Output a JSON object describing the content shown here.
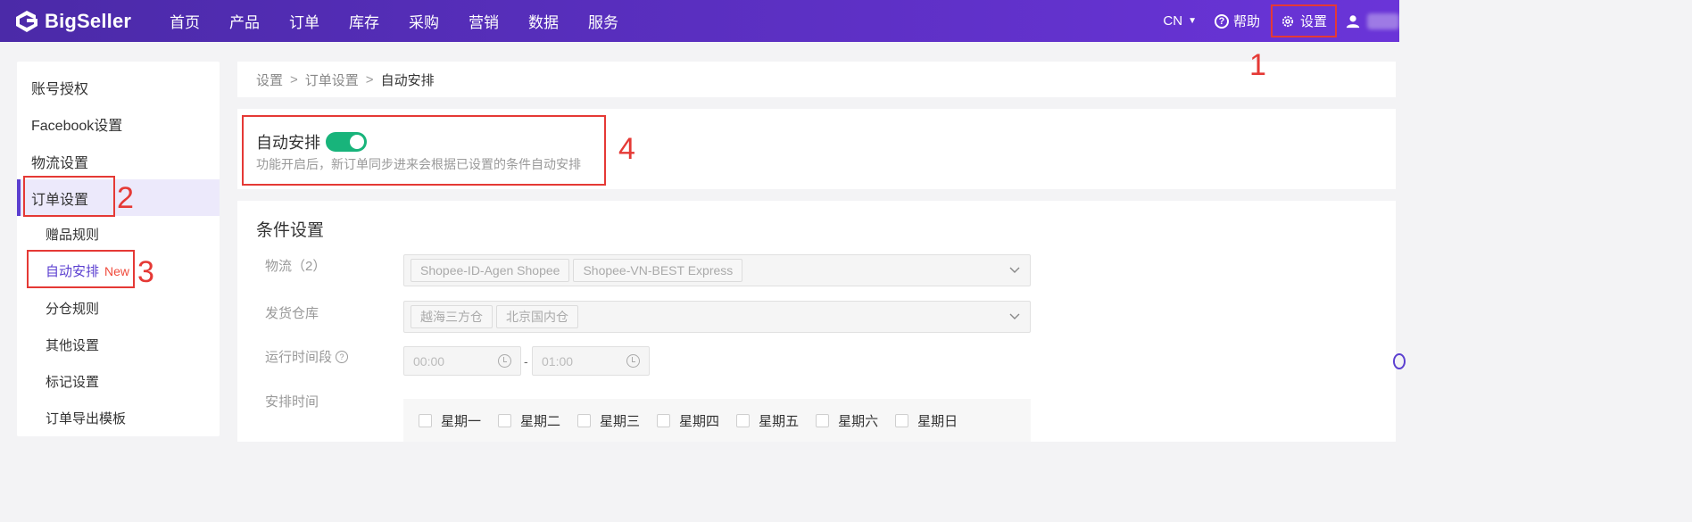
{
  "header": {
    "brand": "BigSeller",
    "nav": [
      "首页",
      "产品",
      "订单",
      "库存",
      "采购",
      "营销",
      "数据",
      "服务"
    ],
    "lang": "CN",
    "help_label": "帮助",
    "settings_label": "设置"
  },
  "sidebar": {
    "items": [
      {
        "label": "账号授权"
      },
      {
        "label": "Facebook设置"
      },
      {
        "label": "物流设置"
      },
      {
        "label": "订单设置"
      },
      {
        "label": "赠品规则"
      },
      {
        "label": "自动安排",
        "badge": "New"
      },
      {
        "label": "分仓规则"
      },
      {
        "label": "其他设置"
      },
      {
        "label": "标记设置"
      },
      {
        "label": "订单导出模板"
      }
    ]
  },
  "breadcrumb": [
    "设置",
    "订单设置",
    "自动安排"
  ],
  "breadcrumb_sep": ">",
  "auto_arrange": {
    "title": "自动安排",
    "enabled": true,
    "description": "功能开启后，新订单同步进来会根据已设置的条件自动安排"
  },
  "conditions": {
    "title": "条件设置",
    "logistics_label": "物流（2）",
    "logistics_tags": [
      "Shopee-ID-Agen Shopee",
      "Shopee-VN-BEST Express"
    ],
    "warehouse_label": "发货仓库",
    "warehouse_tags": [
      "越海三方仓",
      "北京国内仓"
    ],
    "time_label": "运行时间段",
    "time_start": "00:00",
    "time_end": "01:00",
    "time_sep": "-",
    "schedule_label": "安排时间",
    "weekdays": [
      "星期一",
      "星期二",
      "星期三",
      "星期四",
      "星期五",
      "星期六",
      "星期日"
    ]
  },
  "annotations": [
    "1",
    "2",
    "3",
    "4"
  ],
  "colors": {
    "header_start": "#4b2aa8",
    "header_end": "#6a34d8",
    "accent": "#5b3fd0",
    "toggle_on": "#18b47b",
    "annotation_red": "#e53935",
    "badge_red": "#f04b3c"
  }
}
